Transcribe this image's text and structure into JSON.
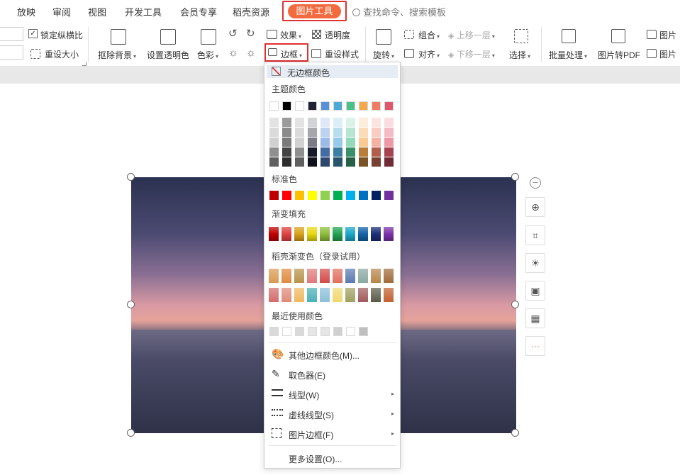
{
  "tabs": {
    "items": [
      "放映",
      "审阅",
      "视图",
      "开发工具",
      "会员专享",
      "稻壳资源"
    ],
    "active": "图片工具",
    "search_placeholder": "查找命令、搜索模板"
  },
  "ribbon": {
    "lock_ratio": "锁定纵横比",
    "reset_size": "重设大小",
    "remove_bg": "抠除背景",
    "set_transparent": "设置透明色",
    "color": "色彩",
    "effects": "效果",
    "transparency": "透明度",
    "border": "边框",
    "reset_style": "重设样式",
    "rotate": "旋转",
    "group": "组合",
    "align": "对齐",
    "move_up": "上移一层",
    "move_down": "下移一层",
    "select": "选择",
    "batch": "批量处理",
    "to_pdf": "图片转PDF",
    "pic_a": "图片",
    "pic_b": "图片"
  },
  "dropdown": {
    "no_border": "无边框颜色",
    "theme_colors": "主题颜色",
    "standard_colors": "标准色",
    "gradient_fill": "渐变填充",
    "docer_gradient": "稻壳渐变色（登录试用）",
    "recent_colors": "最近使用颜色",
    "other_colors": "其他边框颜色(M)...",
    "eyedropper": "取色器(E)",
    "line_type": "线型(W)",
    "dash_type": "虚线线型(S)",
    "pic_border": "图片边框(F)",
    "more_settings": "更多设置(O)..."
  },
  "colors": {
    "accent": "#f26a3d",
    "highlight_red": "#e03030",
    "theme_row": [
      "#ffffff",
      "#000000",
      "#ffffff",
      "#1f2335",
      "#5b8ed8",
      "#4ea9d8",
      "#4cc08a",
      "#f5a84a",
      "#ef7d66",
      "#e0566b"
    ],
    "standard": [
      "#c00000",
      "#ff0000",
      "#ffc000",
      "#ffff00",
      "#92d050",
      "#00b050",
      "#00b0f0",
      "#0070c0",
      "#002060",
      "#7030a0"
    ],
    "gradient": [
      "#c00000",
      "#e04040",
      "#d9a21a",
      "#e8d810",
      "#8ebd3a",
      "#22a352",
      "#1aa8c8",
      "#1463a8",
      "#1c2f78",
      "#7b32a8"
    ],
    "recent": [
      "#d9d9d9",
      "#ffffff",
      "#d9d9d9",
      "#e6e6e6",
      "#e6e6e6",
      "#d0d0d0",
      "#ffffff",
      "#bfbfbf"
    ]
  }
}
